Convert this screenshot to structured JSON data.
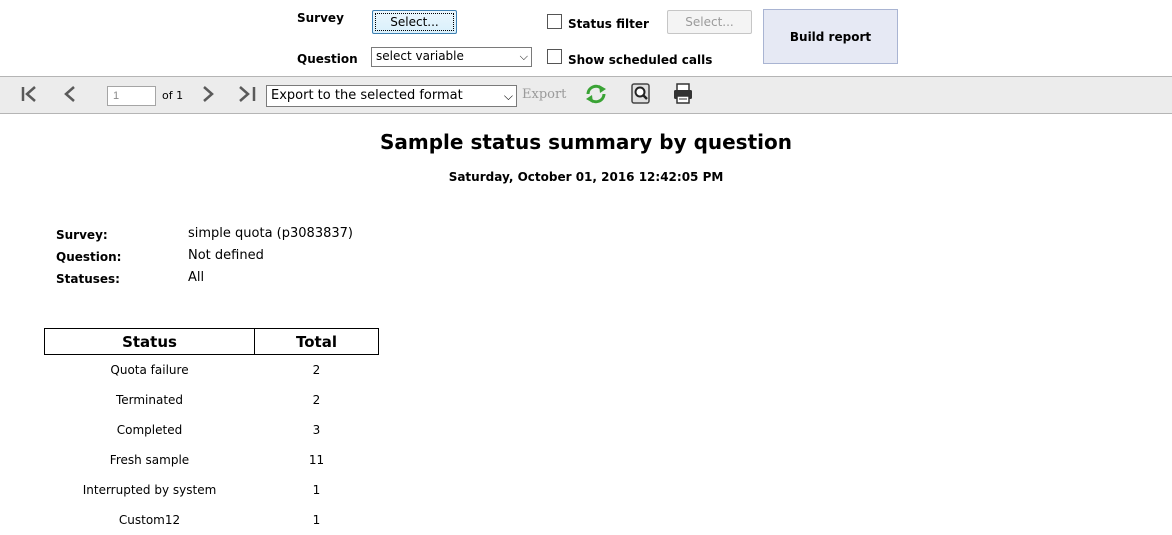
{
  "filters": {
    "survey_label": "Survey",
    "survey_button": "Select...",
    "question_label": "Question",
    "question_select": "select variable",
    "status_filter_label": "Status filter",
    "status_filter_button": "Select...",
    "show_scheduled_label": "Show scheduled calls",
    "build_report": "Build report"
  },
  "toolbar": {
    "page_number": "1",
    "page_of": "of 1",
    "export_format": "Export to the selected format",
    "export_label": "Export",
    "icons": [
      "first-page-icon",
      "prev-page-icon",
      "next-page-icon",
      "last-page-icon",
      "refresh-icon",
      "zoom-icon",
      "print-icon"
    ]
  },
  "report": {
    "title": "Sample status summary by question",
    "date": "Saturday, October 01, 2016 12:42:05 PM",
    "meta": [
      {
        "label": "Survey:",
        "value": "simple quota (p3083837)"
      },
      {
        "label": "Question:",
        "value": "Not defined"
      },
      {
        "label": "Statuses:",
        "value": "All"
      }
    ],
    "table": {
      "headers": [
        "Status",
        "Total"
      ],
      "rows": [
        [
          "Quota failure",
          "2"
        ],
        [
          "Terminated",
          "2"
        ],
        [
          "Completed",
          "3"
        ],
        [
          "Fresh sample",
          "11"
        ],
        [
          "Interrupted by system",
          "1"
        ],
        [
          "Custom12",
          "1"
        ]
      ]
    }
  },
  "colors": {
    "toolbar_bg": "#ececec",
    "build_button_bg": "#e6e9f4",
    "refresh_icon": "#3aa335"
  }
}
